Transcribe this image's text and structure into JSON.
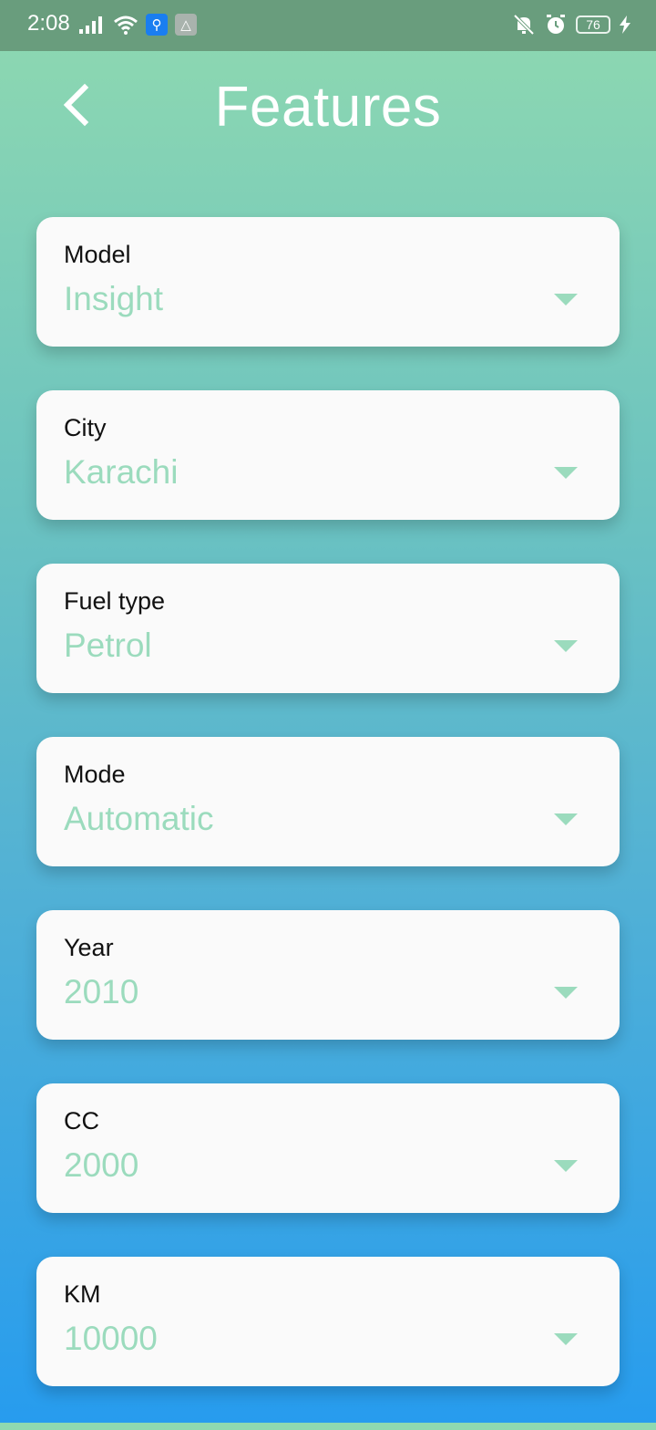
{
  "status_bar": {
    "time": "2:08",
    "battery": "76",
    "icons": [
      "signal-icon",
      "wifi-icon",
      "usb-icon",
      "app-notification-icon",
      "mute-icon",
      "alarm-icon",
      "battery-icon",
      "charging-icon"
    ]
  },
  "header": {
    "title": "Features",
    "back_icon": "chevron-left-icon"
  },
  "fields": [
    {
      "label": "Model",
      "value": "Insight"
    },
    {
      "label": "City",
      "value": "Karachi"
    },
    {
      "label": "Fuel type",
      "value": "Petrol"
    },
    {
      "label": "Mode",
      "value": "Automatic"
    },
    {
      "label": "Year",
      "value": "2010"
    },
    {
      "label": "CC",
      "value": "2000"
    },
    {
      "label": "KM",
      "value": "10000"
    }
  ],
  "colors": {
    "status_bar": "#699d7d",
    "gradient_top": "#8fd9b0",
    "gradient_bottom": "#279cee",
    "value_text": "#9bdbbd",
    "card_bg": "#fafafa"
  }
}
